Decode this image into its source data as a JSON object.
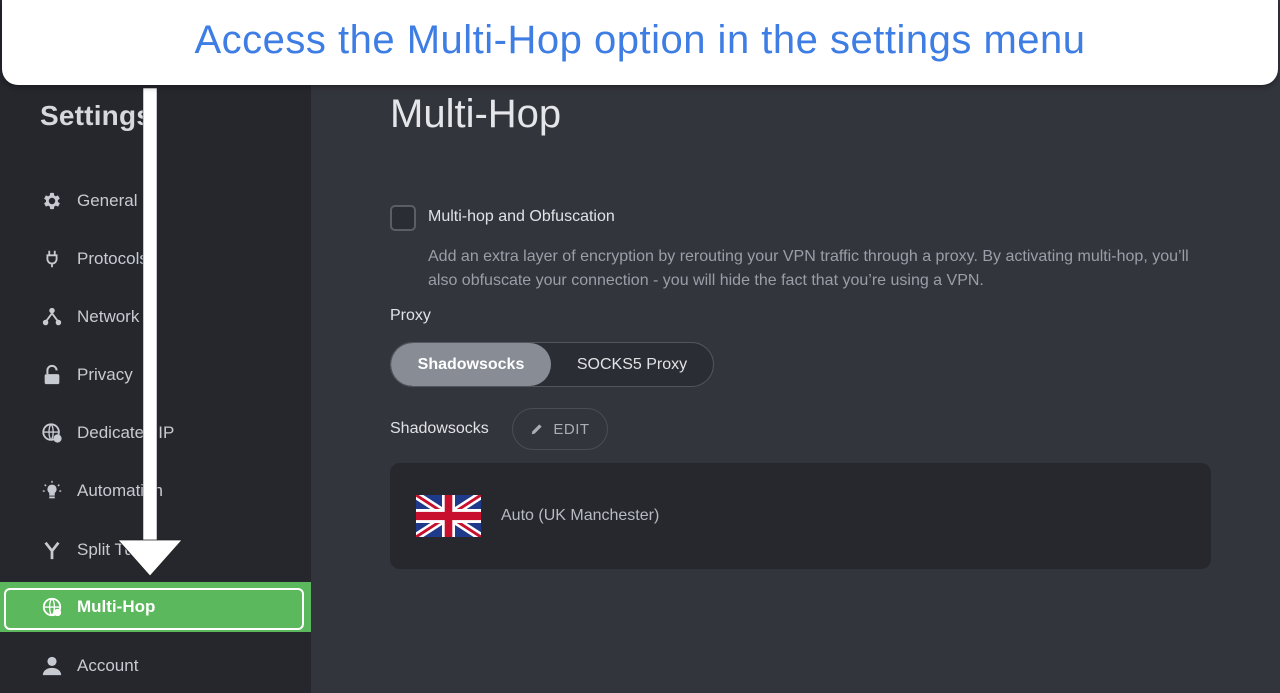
{
  "banner": {
    "text": "Access the Multi-Hop option in the settings menu"
  },
  "sidebar": {
    "title": "Settings",
    "items": [
      {
        "label": "General",
        "icon": "gear-icon"
      },
      {
        "label": "Protocols",
        "icon": "plug-icon"
      },
      {
        "label": "Network",
        "icon": "network-icon"
      },
      {
        "label": "Privacy",
        "icon": "lock-icon"
      },
      {
        "label": "Dedicated IP",
        "icon": "globe-person-icon"
      },
      {
        "label": "Automation",
        "icon": "lightbulb-icon"
      },
      {
        "label": "Split Tunnel",
        "icon": "split-icon"
      },
      {
        "label": "Multi-Hop",
        "icon": "globe-arrows-icon",
        "active": true
      },
      {
        "label": "Account",
        "icon": "person-icon"
      }
    ]
  },
  "main": {
    "title": "Multi-Hop",
    "multihop": {
      "label": "Multi-hop and Obfuscation",
      "checked": false,
      "description": "Add an extra layer of encryption by rerouting your VPN traffic through a proxy. By activating multi-hop, you’ll also obfuscate your connection - you will hide the fact that you’re using a VPN."
    },
    "proxy": {
      "label": "Proxy",
      "options": [
        "Shadowsocks",
        "SOCKS5 Proxy"
      ],
      "selected": "Shadowsocks"
    },
    "shadowsocks": {
      "label": "Shadowsocks",
      "edit_label": "EDIT"
    },
    "server": {
      "name": "Auto (UK Manchester)",
      "flag": "uk-flag-icon"
    }
  },
  "colors": {
    "active": "#5cb85c",
    "banner_text": "#3d7de4",
    "sidebar_bg": "#25272d",
    "main_bg": "#33353d"
  }
}
